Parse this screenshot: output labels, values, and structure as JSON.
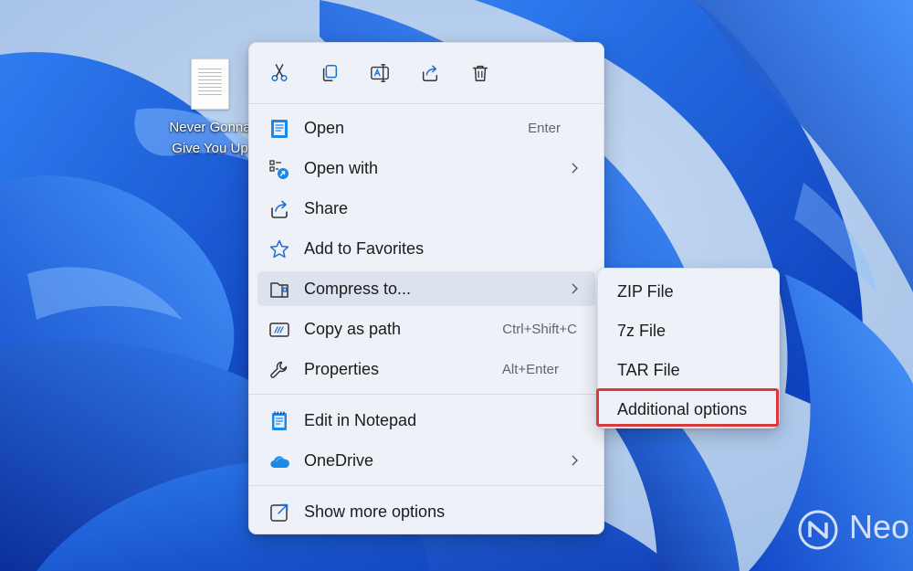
{
  "desktop": {
    "file_icon": {
      "icon": "text-file-icon",
      "label_line1": "Never Gonna",
      "label_line2": "Give You Up"
    }
  },
  "context_menu": {
    "toolbar": [
      {
        "name": "cut-button",
        "icon": "scissors-icon"
      },
      {
        "name": "copy-button",
        "icon": "copy-icon"
      },
      {
        "name": "rename-button",
        "icon": "rename-icon"
      },
      {
        "name": "share-button",
        "icon": "share-icon"
      },
      {
        "name": "delete-button",
        "icon": "trash-icon"
      }
    ],
    "items": [
      {
        "label": "Open",
        "shortcut": "Enter",
        "icon": "notepad-icon"
      },
      {
        "label": "Open with",
        "icon": "open-with-icon",
        "submenu": true
      },
      {
        "label": "Share",
        "icon": "share-icon"
      },
      {
        "label": "Add to Favorites",
        "icon": "star-icon"
      },
      {
        "label": "Compress to...",
        "icon": "zip-folder-icon",
        "submenu": true,
        "hovered": true
      },
      {
        "label": "Copy as path",
        "shortcut": "Ctrl+Shift+C",
        "icon": "copy-path-icon"
      },
      {
        "label": "Properties",
        "shortcut": "Alt+Enter",
        "icon": "wrench-icon"
      },
      {
        "label": "Edit in Notepad",
        "icon": "notepad-icon"
      },
      {
        "label": "OneDrive",
        "icon": "onedrive-cloud-icon",
        "submenu": true
      },
      {
        "label": "Show more options",
        "icon": "external-link-icon"
      }
    ]
  },
  "compress_submenu": {
    "items": [
      {
        "label": "ZIP File"
      },
      {
        "label": "7z File"
      },
      {
        "label": "TAR File"
      },
      {
        "label": "Additional options",
        "highlighted": true
      }
    ]
  },
  "watermark": {
    "text": "Neo",
    "icon": "neowin-logo-icon"
  },
  "colors": {
    "accent": "#0f6cbd",
    "highlight_box": "#d63a3a",
    "menu_bg": "#eef1f8"
  }
}
